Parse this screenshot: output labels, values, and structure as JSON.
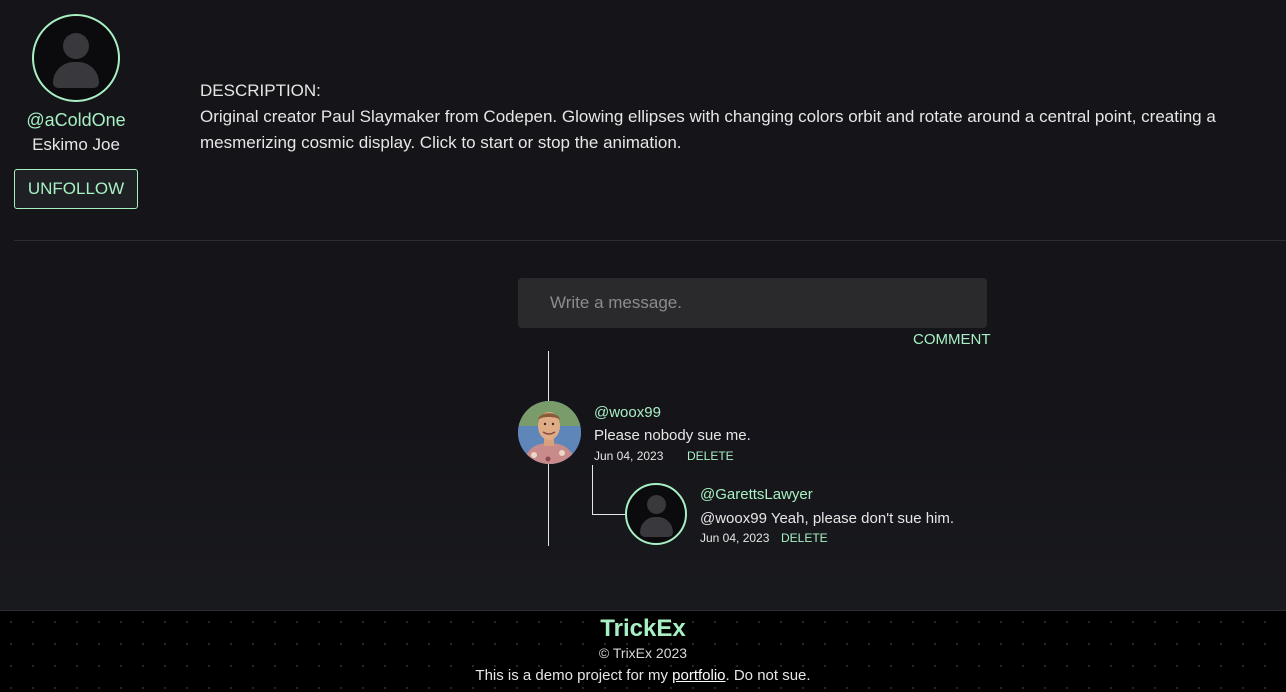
{
  "profile": {
    "handle": "@aColdOne",
    "name": "Eskimo Joe",
    "follow_button": "UNFOLLOW"
  },
  "description": {
    "heading": "DESCRIPTION:",
    "text": "Original creator Paul Slaymaker from Codepen. Glowing ellipses with changing colors orbit and rotate around a central point, creating a mesmerizing cosmic display. Click to start or stop the animation."
  },
  "comment_form": {
    "placeholder": "Write a message.",
    "submit_label": "COMMENT"
  },
  "comments": [
    {
      "user": "@woox99",
      "text": "Please nobody sue me.",
      "date": "Jun 04, 2023",
      "delete_label": "DELETE",
      "replies": [
        {
          "user": "@GarettsLawyer",
          "text": "@woox99 Yeah, please don't sue him.",
          "date": "Jun 04, 2023",
          "delete_label": "DELETE"
        }
      ]
    }
  ],
  "footer": {
    "brand": "TrickEx",
    "copyright": "© TrixEx 2023",
    "note_prefix": "This is a demo project for my ",
    "note_link": "portfolio",
    "note_suffix": ". Do not sue."
  },
  "colors": {
    "accent": "#a8f0c4",
    "background": "#141419",
    "input_bg": "#2a2a2d"
  }
}
